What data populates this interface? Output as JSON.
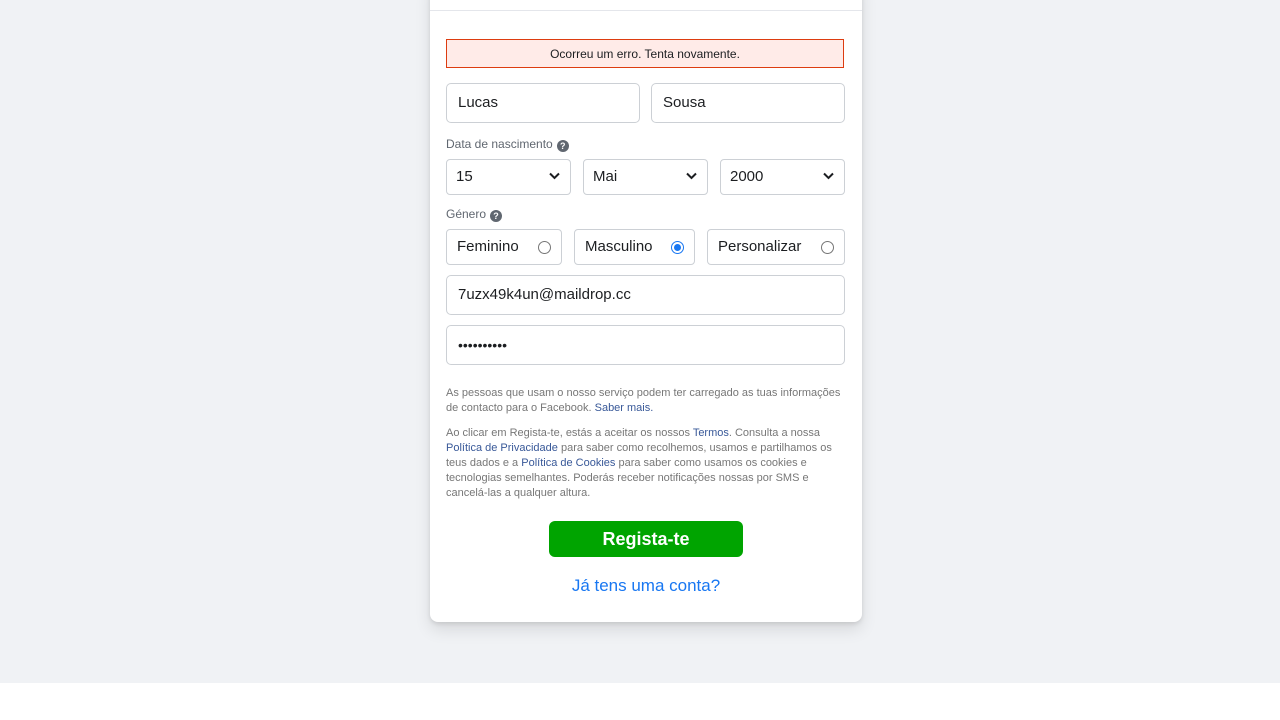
{
  "error_message": "Ocorreu um erro. Tenta novamente.",
  "first_name": {
    "value": "Lucas"
  },
  "last_name": {
    "value": "Sousa"
  },
  "birthday": {
    "label": "Data de nascimento",
    "help_icon": "question-circle-icon",
    "day": "15",
    "month": "Mai",
    "year": "2000"
  },
  "gender": {
    "label": "Género",
    "help_icon": "question-circle-icon",
    "options": [
      {
        "label": "Feminino",
        "selected": false
      },
      {
        "label": "Masculino",
        "selected": true
      },
      {
        "label": "Personalizar",
        "selected": false
      }
    ]
  },
  "email": {
    "value": "7uzx49k4un@maildrop.cc"
  },
  "password": {
    "value": "••••••••••"
  },
  "contact_notice": {
    "text": "As pessoas que usam o nosso serviço podem ter carregado as tuas informações de contacto para o Facebook.",
    "link": "Saber mais."
  },
  "terms": {
    "t1": "Ao clicar em Regista-te, estás a aceitar os nossos",
    "terms_link": "Termos",
    "t2": ". Consulta a nossa",
    "privacy_link": "Política de Privacidade",
    "t3": "para saber como recolhemos, usamos e partilhamos os teus dados e a",
    "cookies_link": "Política de Cookies",
    "t4": "para saber como usamos os cookies e tecnologias semelhantes. Poderás receber notificações nossas por SMS e cancelá-las a qualquer altura."
  },
  "submit_label": "Regista-te",
  "login_link": "Já tens uma conta?",
  "colors": {
    "background": "#f0f2f5",
    "submit_green": "#00a400",
    "link_blue": "#1877f2",
    "error_border": "#dd3c10",
    "error_bg": "#ffebe8"
  }
}
